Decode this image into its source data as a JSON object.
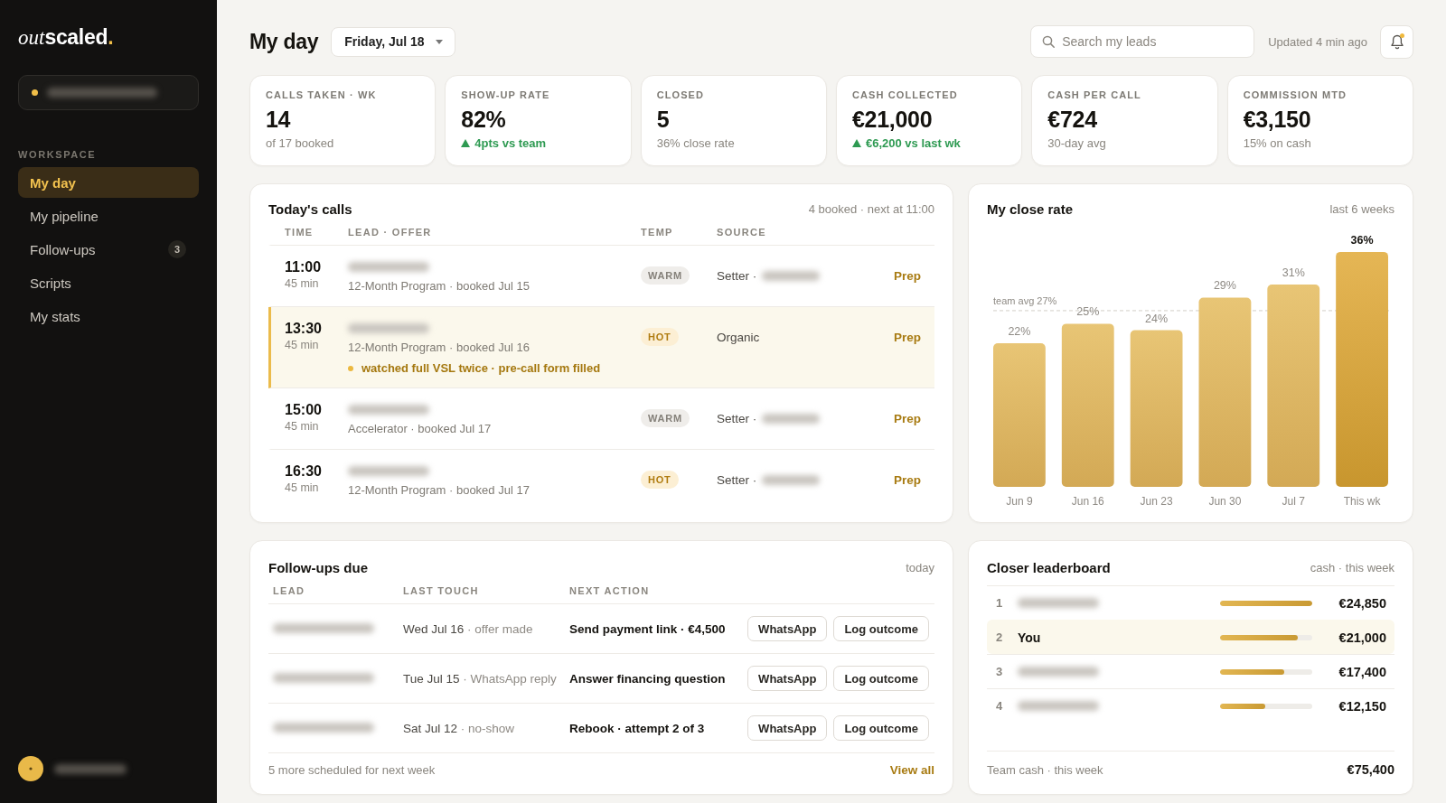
{
  "sidebar": {
    "logo": {
      "parts": [
        {
          "text": "out",
          "kind": "script"
        },
        {
          "text": "scaled",
          "kind": "bold"
        },
        {
          "text": ".",
          "kind": "accent"
        }
      ]
    },
    "workspace": {
      "name_blurred": true
    },
    "section_label": "WORKSPACE",
    "items": [
      {
        "label": "My day",
        "selected": true
      },
      {
        "label": "My pipeline",
        "selected": false
      },
      {
        "label": "Follow-ups",
        "selected": false,
        "badge": "3"
      },
      {
        "label": "Scripts",
        "selected": false
      },
      {
        "label": "My stats",
        "selected": false
      }
    ],
    "user": {
      "name_blurred": true
    }
  },
  "header": {
    "title": "My day",
    "date": "Friday, Jul 18",
    "search": {
      "placeholder": "Search my leads"
    },
    "updated": "Updated 4 min ago",
    "notifications": {
      "unread": true
    }
  },
  "kpis": [
    {
      "label": "CALLS TAKEN · WK",
      "value": "14",
      "sub": "of 17 booked",
      "kind": "plain"
    },
    {
      "label": "SHOW-UP RATE",
      "value": "82%",
      "sub": "4pts vs team",
      "kind": "up"
    },
    {
      "label": "CLOSED",
      "value": "5",
      "sub": "36% close rate",
      "kind": "plain"
    },
    {
      "label": "CASH COLLECTED",
      "value": "€21,000",
      "sub": "€6,200 vs last wk",
      "kind": "up"
    },
    {
      "label": "CASH PER CALL",
      "value": "€724",
      "sub": "30-day avg",
      "kind": "plain"
    },
    {
      "label": "COMMISSION MTD",
      "value": "€3,150",
      "sub": "15% on cash",
      "kind": "plain"
    }
  ],
  "todays_calls": {
    "title": "Today's calls",
    "summary": "4 booked · next at 11:00",
    "columns": [
      "TIME",
      "LEAD · OFFER",
      "TEMP",
      "SOURCE"
    ],
    "rows": [
      {
        "time": "11:00",
        "duration": "45 min",
        "name_blurred": true,
        "offer": "12-Month Program · booked Jul 15",
        "temp": {
          "label": "WARM",
          "kind": "warm"
        },
        "source": "Setter ·",
        "source_name_blurred": true,
        "action": "Prep",
        "highlighted": false
      },
      {
        "time": "13:30",
        "duration": "45 min",
        "name_blurred": true,
        "offer": "12-Month Program · booked Jul 16",
        "note": "watched full VSL twice · pre-call form filled",
        "temp": {
          "label": "HOT",
          "kind": "hot"
        },
        "source": "Organic",
        "source_name_blurred": false,
        "action": "Prep",
        "highlighted": true
      },
      {
        "time": "15:00",
        "duration": "45 min",
        "name_blurred": true,
        "offer": "Accelerator · booked Jul 17",
        "temp": {
          "label": "WARM",
          "kind": "warm"
        },
        "source": "Setter ·",
        "source_name_blurred": true,
        "action": "Prep",
        "highlighted": false
      },
      {
        "time": "16:30",
        "duration": "45 min",
        "name_blurred": true,
        "offer": "12-Month Program · booked Jul 17",
        "temp": {
          "label": "HOT",
          "kind": "hot"
        },
        "source": "Setter ·",
        "source_name_blurred": true,
        "action": "Prep",
        "highlighted": false
      }
    ]
  },
  "close_rate": {
    "title": "My close rate",
    "period": "last 6 weeks",
    "highlight_last": true,
    "chart_data": {
      "type": "bar",
      "categories": [
        "Jun 9",
        "Jun 16",
        "Jun 23",
        "Jun 30",
        "Jul 7",
        "This wk"
      ],
      "values": [
        22,
        25,
        24,
        29,
        31,
        36
      ],
      "data_labels": true,
      "value_labels": [
        "22%",
        "25%",
        "24%",
        "29%",
        "31%",
        "36%"
      ],
      "ref_lines": [
        {
          "axis": "y",
          "value": 27,
          "label": "team avg 27%"
        }
      ]
    }
  },
  "follow_ups": {
    "title": "Follow-ups due",
    "period": "today",
    "columns": [
      "LEAD",
      "LAST TOUCH",
      "NEXT ACTION"
    ],
    "rows": [
      {
        "name_blurred": true,
        "last_touch": "Wed Jul 16",
        "last_touch_note": "· offer made",
        "next_action": "Send payment link · €4,500",
        "actions": [
          "WhatsApp",
          "Log outcome"
        ]
      },
      {
        "name_blurred": true,
        "last_touch": "Tue Jul 15",
        "last_touch_note": "· WhatsApp reply",
        "next_action": "Answer financing question",
        "actions": [
          "WhatsApp",
          "Log outcome"
        ]
      },
      {
        "name_blurred": true,
        "last_touch": "Sat Jul 12",
        "last_touch_note": "· no-show",
        "next_action": "Rebook · attempt 2 of 3",
        "actions": [
          "WhatsApp",
          "Log outcome"
        ]
      }
    ],
    "footer": "5 more scheduled for next week",
    "link": "View all"
  },
  "leaderboard": {
    "title": "Closer leaderboard",
    "period": "cash · this week",
    "rows": [
      {
        "rank": "1",
        "name_blurred": true,
        "level": 1.0,
        "amount": "€24,850",
        "highlighted": false
      },
      {
        "rank": "2",
        "name": "You",
        "name_blurred": false,
        "level": 0.845,
        "amount": "€21,000",
        "highlighted": true
      },
      {
        "rank": "3",
        "name_blurred": true,
        "level": 0.7,
        "amount": "€17,400",
        "highlighted": false
      },
      {
        "rank": "4",
        "name_blurred": true,
        "level": 0.49,
        "amount": "€12,150",
        "highlighted": false
      }
    ],
    "footer_label": "Team cash · this week",
    "footer_value": "€75,400"
  }
}
